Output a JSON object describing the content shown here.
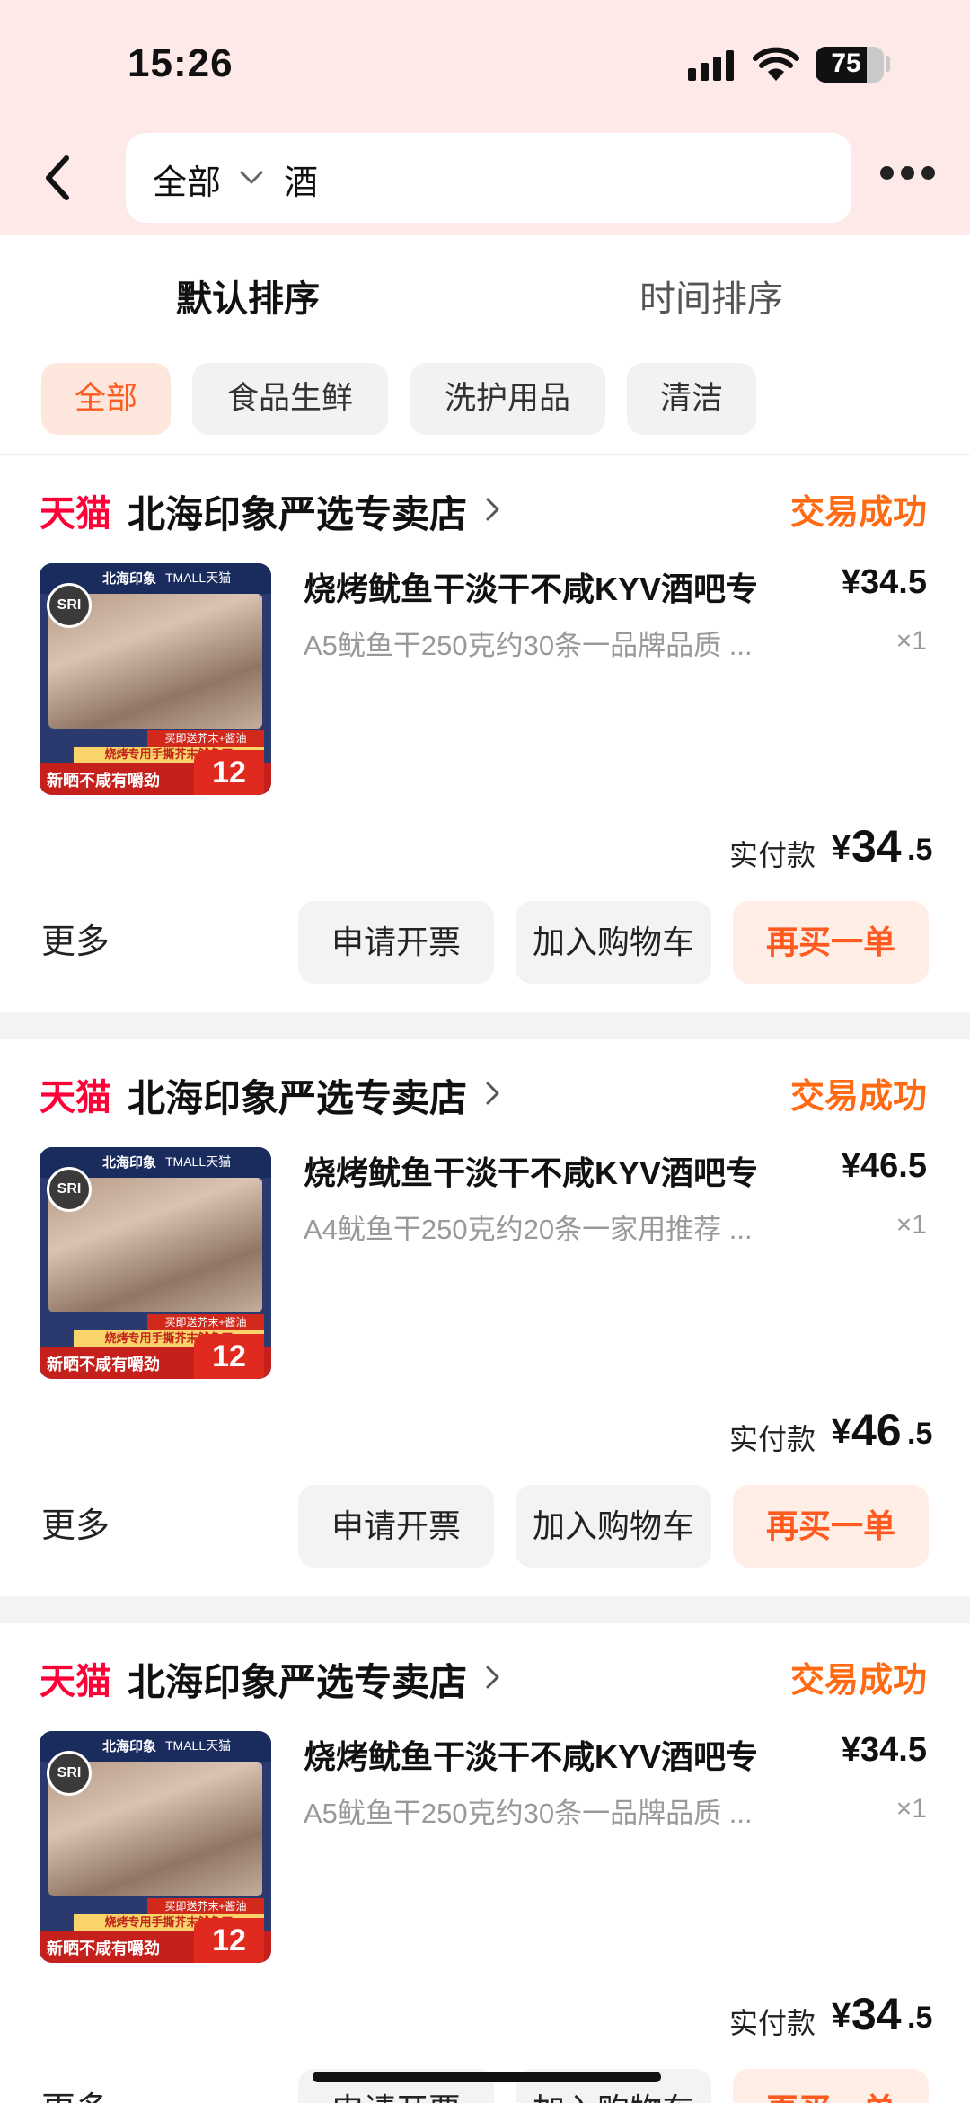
{
  "status_bar": {
    "time": "15:26",
    "battery": "75",
    "battery_level": 0.75
  },
  "search": {
    "scope": "全部",
    "query": "酒"
  },
  "sort_tabs": [
    {
      "label": "默认排序",
      "active": true
    },
    {
      "label": "时间排序",
      "active": false
    }
  ],
  "filter_chips": [
    {
      "label": "全部",
      "active": true
    },
    {
      "label": "食品生鲜",
      "active": false
    },
    {
      "label": "洗护用品",
      "active": false
    },
    {
      "label": "清洁",
      "active": false
    }
  ],
  "orders": [
    {
      "platform": "天猫",
      "shop": "北海印象严选专卖店",
      "status": "交易成功",
      "product_title": "烧烤鱿鱼干淡干不咸KYV酒吧专",
      "price": "¥34.5",
      "sku": "A5鱿鱼干250克约30条一品牌品质 ...",
      "qty": "×1",
      "paid_label": "实付款",
      "paid_currency": "¥",
      "paid_int": "34",
      "paid_dec": ".5",
      "thumb": {
        "brand": "北海印象",
        "brand2": "TMALL天猫",
        "badge": "SRI",
        "tag1": "买即送芥末+酱油",
        "tag2": "烧烤专用手撕芥末鱿鱼干",
        "slogan": "新晒不咸有嚼劲",
        "price": "12"
      },
      "more": "更多",
      "btn_invoice": "申请开票",
      "btn_cart": "加入购物车",
      "btn_rebuy": "再买一单"
    },
    {
      "platform": "天猫",
      "shop": "北海印象严选专卖店",
      "status": "交易成功",
      "product_title": "烧烤鱿鱼干淡干不咸KYV酒吧专",
      "price": "¥46.5",
      "sku": "A4鱿鱼干250克约20条一家用推荐 ...",
      "qty": "×1",
      "paid_label": "实付款",
      "paid_currency": "¥",
      "paid_int": "46",
      "paid_dec": ".5",
      "thumb": {
        "brand": "北海印象",
        "brand2": "TMALL天猫",
        "badge": "SRI",
        "tag1": "买即送芥末+酱油",
        "tag2": "烧烤专用手撕芥末鱿鱼干",
        "slogan": "新晒不咸有嚼劲",
        "price": "12"
      },
      "more": "更多",
      "btn_invoice": "申请开票",
      "btn_cart": "加入购物车",
      "btn_rebuy": "再买一单"
    },
    {
      "platform": "天猫",
      "shop": "北海印象严选专卖店",
      "status": "交易成功",
      "product_title": "烧烤鱿鱼干淡干不咸KYV酒吧专",
      "price": "¥34.5",
      "sku": "A5鱿鱼干250克约30条一品牌品质 ...",
      "qty": "×1",
      "paid_label": "实付款",
      "paid_currency": "¥",
      "paid_int": "34",
      "paid_dec": ".5",
      "thumb": {
        "brand": "北海印象",
        "brand2": "TMALL天猫",
        "badge": "SRI",
        "tag1": "买即送芥末+酱油",
        "tag2": "烧烤专用手撕芥末鱿鱼干",
        "slogan": "新晒不咸有嚼劲",
        "price": "12"
      },
      "more": "更多",
      "btn_invoice": "申请开票",
      "btn_cart": "加入购物车",
      "btn_rebuy": "再买一单"
    }
  ],
  "colors": {
    "accent": "#ff5a1f",
    "tmall_red": "#ff0036",
    "header_bg": "#fde9e7"
  }
}
